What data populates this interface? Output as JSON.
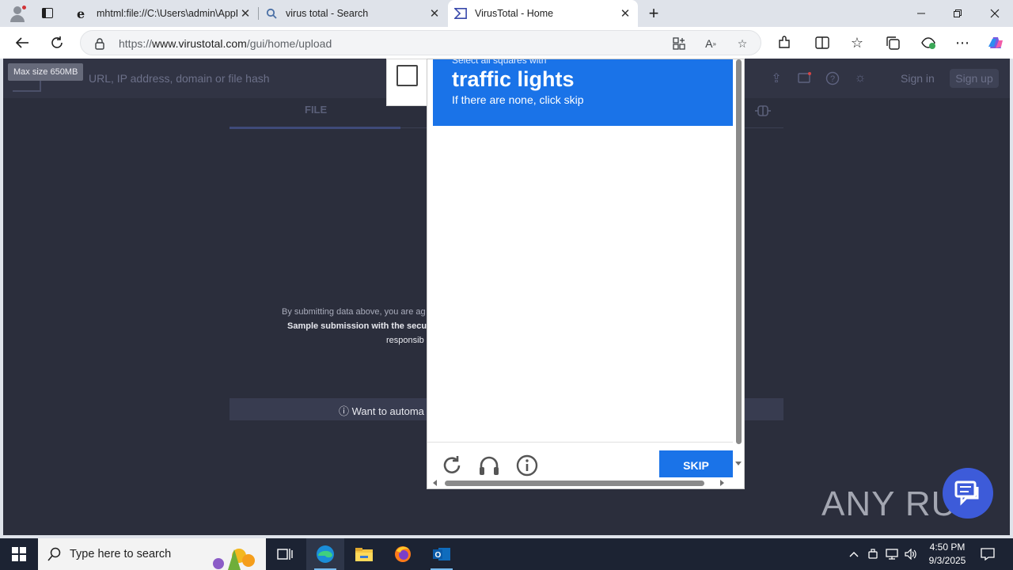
{
  "browser": {
    "tabs": [
      {
        "title": "mhtml:file://C:\\Users\\admin\\AppD",
        "icon": "ie-icon"
      },
      {
        "title": "virus total - Search",
        "icon": "search-icon"
      },
      {
        "title": "VirusTotal - Home",
        "icon": "virustotal-icon",
        "active": true
      }
    ],
    "url_prefix": "https://",
    "url_host": "www.virustotal.com",
    "url_path": "/gui/home/upload"
  },
  "page": {
    "tooltip": "Max size 650MB",
    "search_placeholder": "URL, IP address, domain or file hash",
    "sign_in": "Sign in",
    "sign_up": "Sign up",
    "tab_file": "FILE",
    "terms_line1": "By submitting data above, you are ag",
    "terms_line2": "Sample submission with the secu",
    "terms_line3": "responsib",
    "automate": "ⓘ Want to automa"
  },
  "captcha": {
    "instruction_small": "Select all squares with",
    "target": "traffic lights",
    "hint": "If there are none, click skip",
    "skip_label": "SKIP"
  },
  "watermark": "ANY RUN",
  "taskbar": {
    "search_placeholder": "Type here to search",
    "time": "4:50 PM",
    "date": "9/3/2025"
  },
  "colors": {
    "captcha_blue": "#1a73e8",
    "vt_bg": "#2b2e3c",
    "taskbar": "#1c2333"
  }
}
